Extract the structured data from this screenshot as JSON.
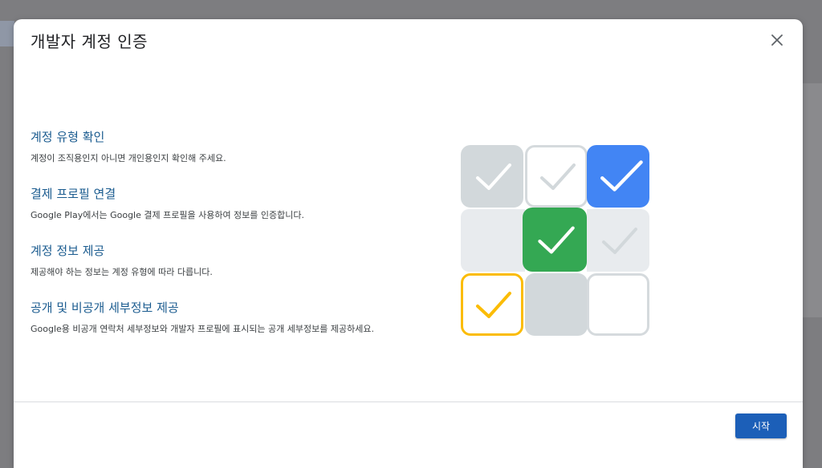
{
  "dialog": {
    "title": "개발자 계정 인증",
    "close_icon": "close-icon"
  },
  "steps": [
    {
      "title": "계정 유형 확인",
      "description": "계정이 조직용인지 아니면 개인용인지 확인해 주세요."
    },
    {
      "title": "결제 프로필 연결",
      "description": "Google Play에서는 Google 결제 프로필을 사용하여 정보를 인증합니다."
    },
    {
      "title": "계정 정보 제공",
      "description": "제공해야 하는 정보는 계정 유형에 따라 다릅니다."
    },
    {
      "title": "공개 및 비공개 세부정보 제공",
      "description": "Google용 비공개 연락처 세부정보와 개발자 프로필에 표시되는 공개 세부정보를 제공하세요."
    }
  ],
  "illustration": {
    "icon": "checkmark-grid-icon",
    "colors": {
      "blue": "#4285f4",
      "green": "#34a853",
      "yellow": "#fbbc04",
      "gray": "#d2d8db",
      "light": "#e8ebee"
    }
  },
  "footer": {
    "start_label": "시작",
    "accent": "#1c5fb8"
  }
}
